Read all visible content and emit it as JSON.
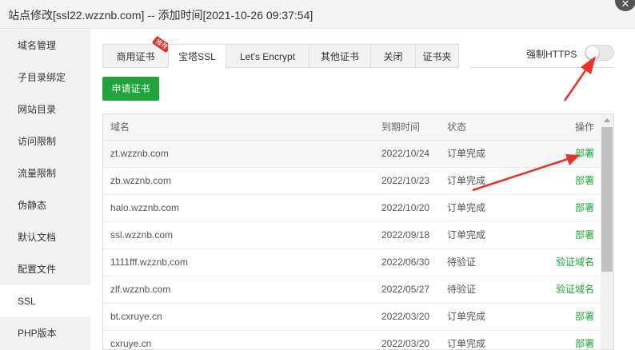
{
  "window": {
    "title": "站点修改[ssl22.wzznb.com] -- 添加时间[2021-10-26 09:37:54]",
    "close_glyph": "✕"
  },
  "sidebar": {
    "items": [
      {
        "label": "域名管理"
      },
      {
        "label": "子目录绑定"
      },
      {
        "label": "网站目录"
      },
      {
        "label": "访问限制"
      },
      {
        "label": "流量限制"
      },
      {
        "label": "伪静态"
      },
      {
        "label": "默认文档"
      },
      {
        "label": "配置文件"
      },
      {
        "label": "SSL"
      },
      {
        "label": "PHP版本"
      }
    ],
    "active": "SSL"
  },
  "tabs": {
    "items": [
      {
        "label": "商用证书",
        "badge": "推荐"
      },
      {
        "label": "宝塔SSL"
      },
      {
        "label": "Let's Encrypt"
      },
      {
        "label": "其他证书"
      },
      {
        "label": "关闭"
      },
      {
        "label": "证书夹"
      }
    ],
    "active": "宝塔SSL"
  },
  "force_https": {
    "label": "强制HTTPS",
    "enabled": false
  },
  "apply_button": {
    "label": "申请证书"
  },
  "table": {
    "headers": {
      "domain": "域名",
      "expire": "到期时间",
      "status": "状态",
      "action": "操作"
    },
    "rows": [
      {
        "domain": "zt.wzznb.com",
        "expire": "2022/10/24",
        "status": "订单完成",
        "action": "部署"
      },
      {
        "domain": "zb.wzznb.com",
        "expire": "2022/10/23",
        "status": "订单完成",
        "action": "部署"
      },
      {
        "domain": "halo.wzznb.com",
        "expire": "2022/10/20",
        "status": "订单完成",
        "action": "部署"
      },
      {
        "domain": "ssl.wzznb.com",
        "expire": "2022/09/18",
        "status": "订单完成",
        "action": "部署"
      },
      {
        "domain": "1111fff.wzznb.com",
        "expire": "2022/06/30",
        "status": "待验证",
        "action": "验证域名"
      },
      {
        "domain": "zlf.wzznb.com",
        "expire": "2022/05/27",
        "status": "待验证",
        "action": "验证域名"
      },
      {
        "domain": "bt.cxruye.cn",
        "expire": "2022/03/20",
        "status": "订单完成",
        "action": "部署"
      },
      {
        "domain": "cxruye.cn",
        "expire": "2022/03/20",
        "status": "订单完成",
        "action": "部署"
      }
    ]
  },
  "colors": {
    "accent_green": "#20a53a",
    "annotation_red": "#e8332b",
    "badge_red": "#d9342b"
  }
}
